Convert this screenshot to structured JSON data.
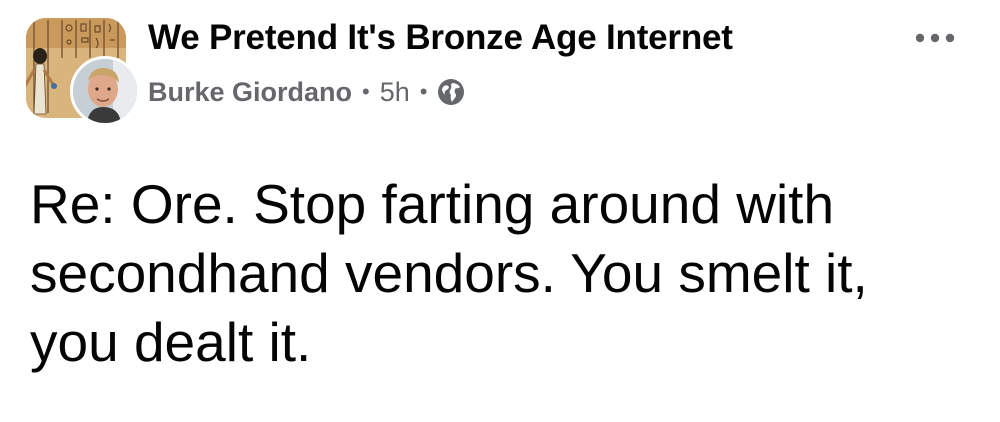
{
  "post": {
    "group_name": "We Pretend It's Bronze Age Internet",
    "author": "Burke Giordano",
    "separator": "•",
    "timestamp": "5h",
    "audience_icon": "globe-icon",
    "more_icon": "more-options-icon",
    "text": "Re: Ore.  Stop farting around with secondhand vendors.  You smelt it, you dealt it."
  },
  "colors": {
    "primary_text": "#050505",
    "secondary_text": "#65676b",
    "background": "#ffffff"
  }
}
